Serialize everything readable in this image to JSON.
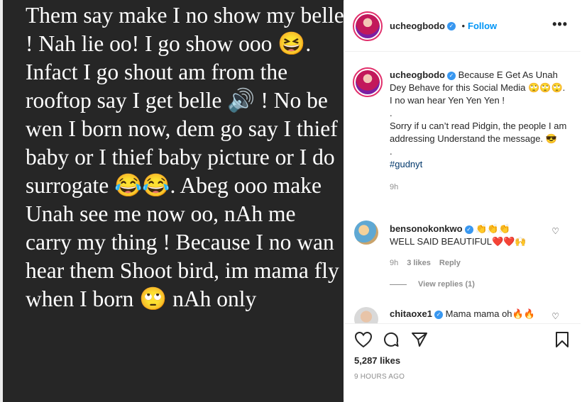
{
  "post": {
    "image_text": "Them say make I no show my belle ! Nah lie oo! I go show ooo 😆. Infact I go shout am from the rooftop say I get belle 🔊 ! No be wen I born now, dem go say I thief baby or I thief baby picture or I do surrogate 😂😂. Abeg ooo make Unah see me now oo, nAh me carry my thing ! Because I no wan hear them Shoot bird, im mama fly when I born 🙄 nAh only"
  },
  "header": {
    "username": "ucheogbodo",
    "separator": "•",
    "follow_label": "Follow",
    "more_label": "•••"
  },
  "caption": {
    "username": "ucheogbodo",
    "line1": "Because E Get As Unah Dey Behave for this Social Media 🙄🙄🙄. I no wan hear Yen Yen Yen !",
    "line2": ".",
    "line3": "Sorry if u can’t read Pidgin, the people I am addressing Understand the message. 😎",
    "line4": ".",
    "hashtag": "#gudnyt",
    "time": "9h"
  },
  "comments": [
    {
      "username": "bensonokonkwo",
      "text_inline": "👏👏👏",
      "text": "WELL SAID BEAUTIFUL❤️❤️🙌",
      "time": "9h",
      "likes": "3 likes",
      "reply_label": "Reply",
      "view_replies": "View replies (1)"
    },
    {
      "username": "chitaoxe1",
      "text_inline": "Mama mama oh🔥🔥"
    }
  ],
  "actions": {
    "likes": "5,287 likes",
    "timestamp": "9 HOURS AGO"
  }
}
